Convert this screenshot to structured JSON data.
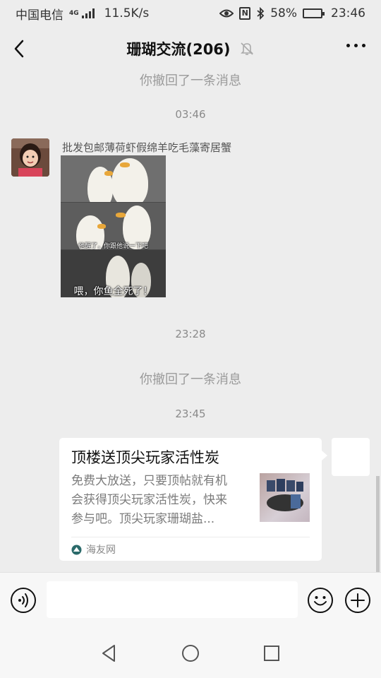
{
  "status": {
    "carrier": "中国电信",
    "network": "4G",
    "speed": "11.5K/s",
    "battery": "58%",
    "battery_level": 0.58,
    "time": "23:46"
  },
  "header": {
    "title": "珊瑚交流(206)",
    "back_icon": "chevron-left-icon",
    "mute_icon": "bell-off-icon",
    "more_icon": "more-horizontal-icon"
  },
  "chat": {
    "messages": [
      {
        "type": "system",
        "text": "你撤回了一条消息"
      },
      {
        "type": "time",
        "text": "03:46"
      },
      {
        "type": "sticker",
        "sender": "批发包邮薄荷虾假绵羊吃毛藻寄居蟹",
        "caption_1": "他醒了，你跟他说一下吧",
        "caption_2": "喂，你鱼全死了！"
      },
      {
        "type": "time",
        "text": "23:28"
      },
      {
        "type": "system",
        "text": "你撤回了一条消息"
      },
      {
        "type": "time",
        "text": "23:45"
      },
      {
        "type": "link_card",
        "title": "顶楼送顶尖玩家活性炭",
        "desc_lines": [
          "免费大放送，只要顶帖就有机",
          "会获得顶尖玩家活性炭，快来",
          "参与吧。顶尖玩家珊瑚盐..."
        ],
        "source": "海友网"
      }
    ]
  },
  "input": {
    "voice_icon": "voice-icon",
    "emoji_icon": "emoji-icon",
    "plus_icon": "plus-icon",
    "value": ""
  },
  "nav": {
    "back_icon": "triangle-back-icon",
    "home_icon": "circle-home-icon",
    "recents_icon": "square-recents-icon"
  }
}
